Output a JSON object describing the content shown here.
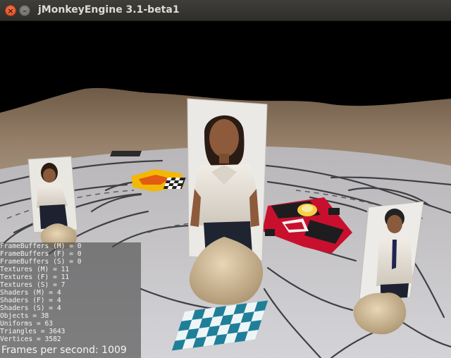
{
  "window": {
    "title": "jMonkeyEngine 3.1-beta1",
    "close_glyph": "×",
    "minimize_glyph": "–"
  },
  "stats": {
    "lines": [
      "FrameBuffers (M) = 0",
      "FrameBuffers (F) = 0",
      "FrameBuffers (S) = 0",
      "Textures (M) = 11",
      "Textures (F) = 11",
      "Textures (S) = 7",
      "Shaders (M) = 4",
      "Shaders (F) = 4",
      "Shaders (S) = 4",
      "Objects = 38",
      "Uniforms = 63",
      "Triangles = 3643",
      "Vertices = 3582"
    ],
    "fps": "Frames per second: 1009"
  },
  "colors": {
    "sky": "#000000",
    "terrain": "#8a7560",
    "floor": "#c9c9cc",
    "track": "#3f3f44",
    "car_red": "#c8102e",
    "flag_teal": "#2f8fa6",
    "rock": "#d6c2a0"
  },
  "icons": {
    "close": "close-icon",
    "minimize": "minimize-icon"
  }
}
